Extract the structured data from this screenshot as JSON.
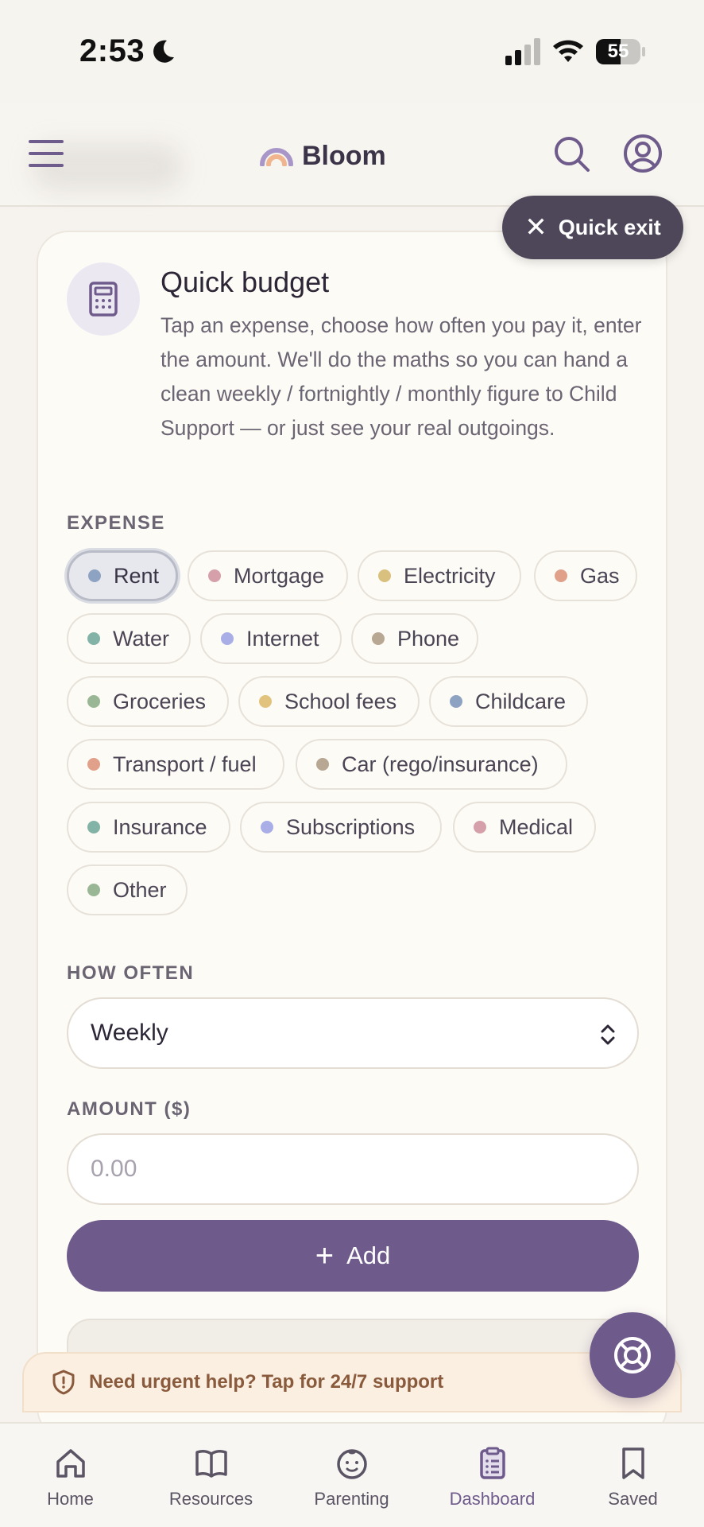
{
  "status_bar": {
    "time": "2:53",
    "battery": "55",
    "battery_level": 0.55
  },
  "header": {
    "app_name": "Bloom"
  },
  "quick_exit": {
    "label": "Quick exit"
  },
  "card": {
    "title": "Quick budget",
    "description": "Tap an expense, choose how often you pay it, enter the amount. We'll do the maths so you can hand a clean weekly / fortnightly / monthly figure to Child Support — or just see your real outgoings.",
    "expense_label": "EXPENSE",
    "expenses": [
      {
        "label": "Rent",
        "color": "#8ea3c2",
        "selected": true
      },
      {
        "label": "Mortgage",
        "color": "#d6a0aa",
        "selected": false
      },
      {
        "label": "Electricity",
        "color": "#d9c07e",
        "selected": false
      },
      {
        "label": "Gas",
        "color": "#e0a08a",
        "selected": false
      },
      {
        "label": "Water",
        "color": "#82b3a6",
        "selected": false
      },
      {
        "label": "Internet",
        "color": "#a9aee6",
        "selected": false
      },
      {
        "label": "Phone",
        "color": "#b8a793",
        "selected": false
      },
      {
        "label": "Groceries",
        "color": "#9ab795",
        "selected": false
      },
      {
        "label": "School fees",
        "color": "#e2c37e",
        "selected": false
      },
      {
        "label": "Childcare",
        "color": "#8ea3c2",
        "selected": false
      },
      {
        "label": "Transport / fuel",
        "color": "#e0a08a",
        "selected": false
      },
      {
        "label": "Car (rego/insurance)",
        "color": "#b8a793",
        "selected": false
      },
      {
        "label": "Insurance",
        "color": "#82b3a6",
        "selected": false
      },
      {
        "label": "Subscriptions",
        "color": "#a9aee6",
        "selected": false
      },
      {
        "label": "Medical",
        "color": "#d6a0aa",
        "selected": false
      },
      {
        "label": "Other",
        "color": "#9ab795",
        "selected": false
      }
    ],
    "how_often_label": "HOW OFTEN",
    "how_often_value": "Weekly",
    "amount_label": "AMOUNT ($)",
    "amount_placeholder": "0.00",
    "add_label": "Add"
  },
  "urgent": {
    "label": "Need urgent help? Tap for 24/7 support"
  },
  "tabs": [
    {
      "label": "Home",
      "icon": "home-icon",
      "active": false
    },
    {
      "label": "Resources",
      "icon": "book-icon",
      "active": false
    },
    {
      "label": "Parenting",
      "icon": "baby-face-icon",
      "active": false
    },
    {
      "label": "Dashboard",
      "icon": "clipboard-icon",
      "active": true
    },
    {
      "label": "Saved",
      "icon": "bookmark-icon",
      "active": false
    }
  ],
  "colors": {
    "accent": "#6e5b8c",
    "quick_exit_bg": "#4e4759",
    "urgent_bg": "#fbefe2"
  }
}
